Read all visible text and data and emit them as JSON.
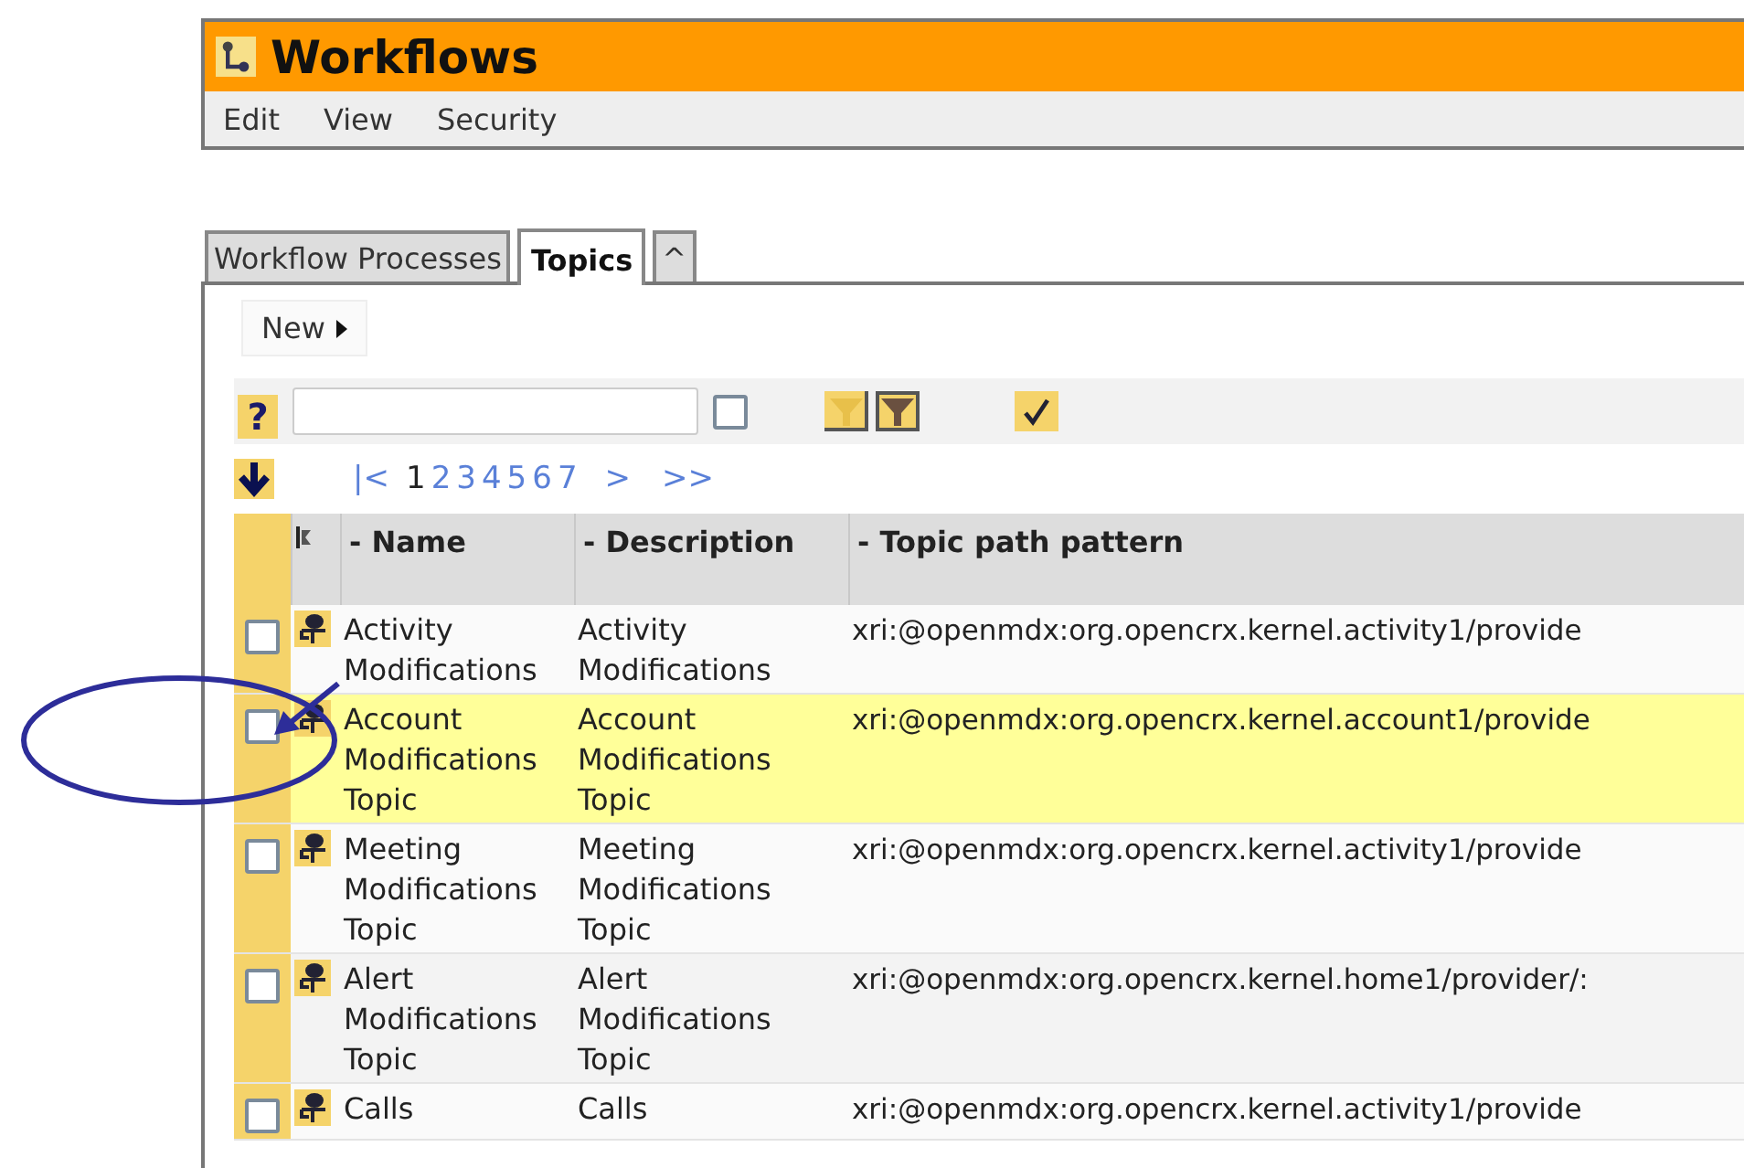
{
  "window": {
    "title": "Workflows"
  },
  "menu": [
    "Edit",
    "View",
    "Security"
  ],
  "tabs": [
    {
      "label": "Workflow Processes",
      "selected": false
    },
    {
      "label": "Topics",
      "selected": true
    },
    {
      "label": "^",
      "selected": false
    }
  ],
  "new_button": {
    "label": "New"
  },
  "filter": {
    "help": "?",
    "checked": false
  },
  "pager": {
    "first": "|<",
    "pages": [
      {
        "label": "1",
        "selected": true
      },
      {
        "label": "2",
        "selected": false
      },
      {
        "label": "3",
        "selected": false
      },
      {
        "label": "4",
        "selected": false
      },
      {
        "label": "5",
        "selected": false
      },
      {
        "label": "6",
        "selected": false
      },
      {
        "label": "7",
        "selected": false
      }
    ],
    "next": ">",
    "last": ">>"
  },
  "table": {
    "columns": [
      "- Name",
      "- Description",
      "- Topic path pattern"
    ],
    "rows": [
      {
        "name": "Activity Modifications",
        "description": "Activity Modifications",
        "path": "xri:@openmdx:org.opencrx.kernel.activity1/provide",
        "selected": false,
        "checked": false
      },
      {
        "name": "Account Modifications Topic",
        "description": "Account Modifications Topic",
        "path": "xri:@openmdx:org.opencrx.kernel.account1/provide",
        "selected": true,
        "checked": false
      },
      {
        "name": "Meeting Modifications Topic",
        "description": "Meeting Modifications Topic",
        "path": "xri:@openmdx:org.opencrx.kernel.activity1/provide",
        "selected": false,
        "checked": false
      },
      {
        "name": "Alert Modifications Topic",
        "description": "Alert Modifications Topic",
        "path": "xri:@openmdx:org.opencrx.kernel.home1/provider/:",
        "selected": false,
        "checked": false
      },
      {
        "name": "Calls",
        "description": "Calls",
        "path": "xri:@openmdx:org.opencrx.kernel.activity1/provide",
        "selected": false,
        "checked": false
      }
    ]
  }
}
